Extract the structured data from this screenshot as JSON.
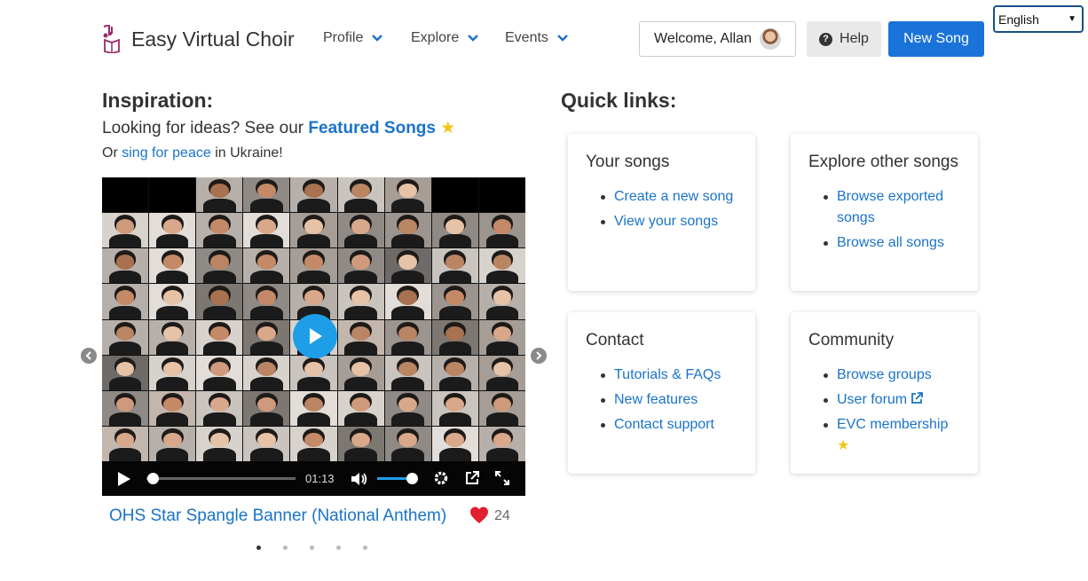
{
  "language": {
    "selected": "English"
  },
  "brand": {
    "name": "Easy Virtual Choir"
  },
  "nav": [
    {
      "label": "Profile"
    },
    {
      "label": "Explore"
    },
    {
      "label": "Events"
    }
  ],
  "header": {
    "welcome": "Welcome, Allan",
    "help": "Help",
    "new_song": "New Song"
  },
  "inspiration": {
    "title": "Inspiration:",
    "line1_prefix": "Looking for ideas? See our",
    "featured_link": "Featured Songs",
    "line2_prefix": "Or",
    "peace_link": "sing for peace",
    "line2_suffix": "in Ukraine!"
  },
  "video": {
    "time": "01:13",
    "progress_fraction": 0.02,
    "volume_fraction": 1.0
  },
  "song": {
    "title": "OHS Star Spangle Banner (National Anthem)",
    "likes": "24"
  },
  "carousel": {
    "count": 5,
    "active": 0
  },
  "quick_links": {
    "title": "Quick links:",
    "cards": [
      {
        "title": "Your songs",
        "links": [
          "Create a new song",
          "View your songs"
        ]
      },
      {
        "title": "Explore other songs",
        "links": [
          "Browse exported songs",
          "Browse all songs"
        ]
      },
      {
        "title": "Contact",
        "links": [
          "Tutorials & FAQs",
          "New features",
          "Contact support"
        ]
      },
      {
        "title": "Community",
        "links": [
          "Browse groups",
          "User forum",
          "EVC membership"
        ]
      }
    ]
  },
  "colors": {
    "primary": "#1a73d8",
    "link": "#1a73c8",
    "play": "#1e9ee8",
    "star": "#f5c518",
    "heart": "#e0202e"
  }
}
